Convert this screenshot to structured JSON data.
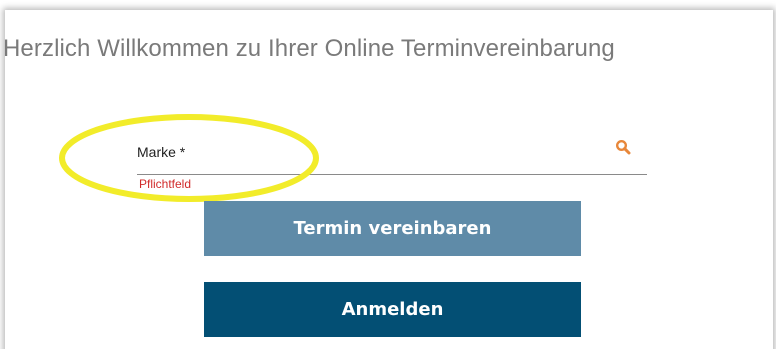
{
  "page": {
    "title": "Herzlich Willkommen zu Ihrer Online Terminvereinbarung"
  },
  "brand_field": {
    "label": "Marke *",
    "error": "Pflichtfeld",
    "icon": "search-icon"
  },
  "buttons": {
    "termin_label": "Termin vereinbaren",
    "anmelden_label": "Anmelden"
  },
  "colors": {
    "termin_button": "#5f8ba8",
    "anmelden_button": "#034f74",
    "error_text": "#d12b2b",
    "search_icon": "#e8873a",
    "highlight": "#f2ec2a"
  }
}
